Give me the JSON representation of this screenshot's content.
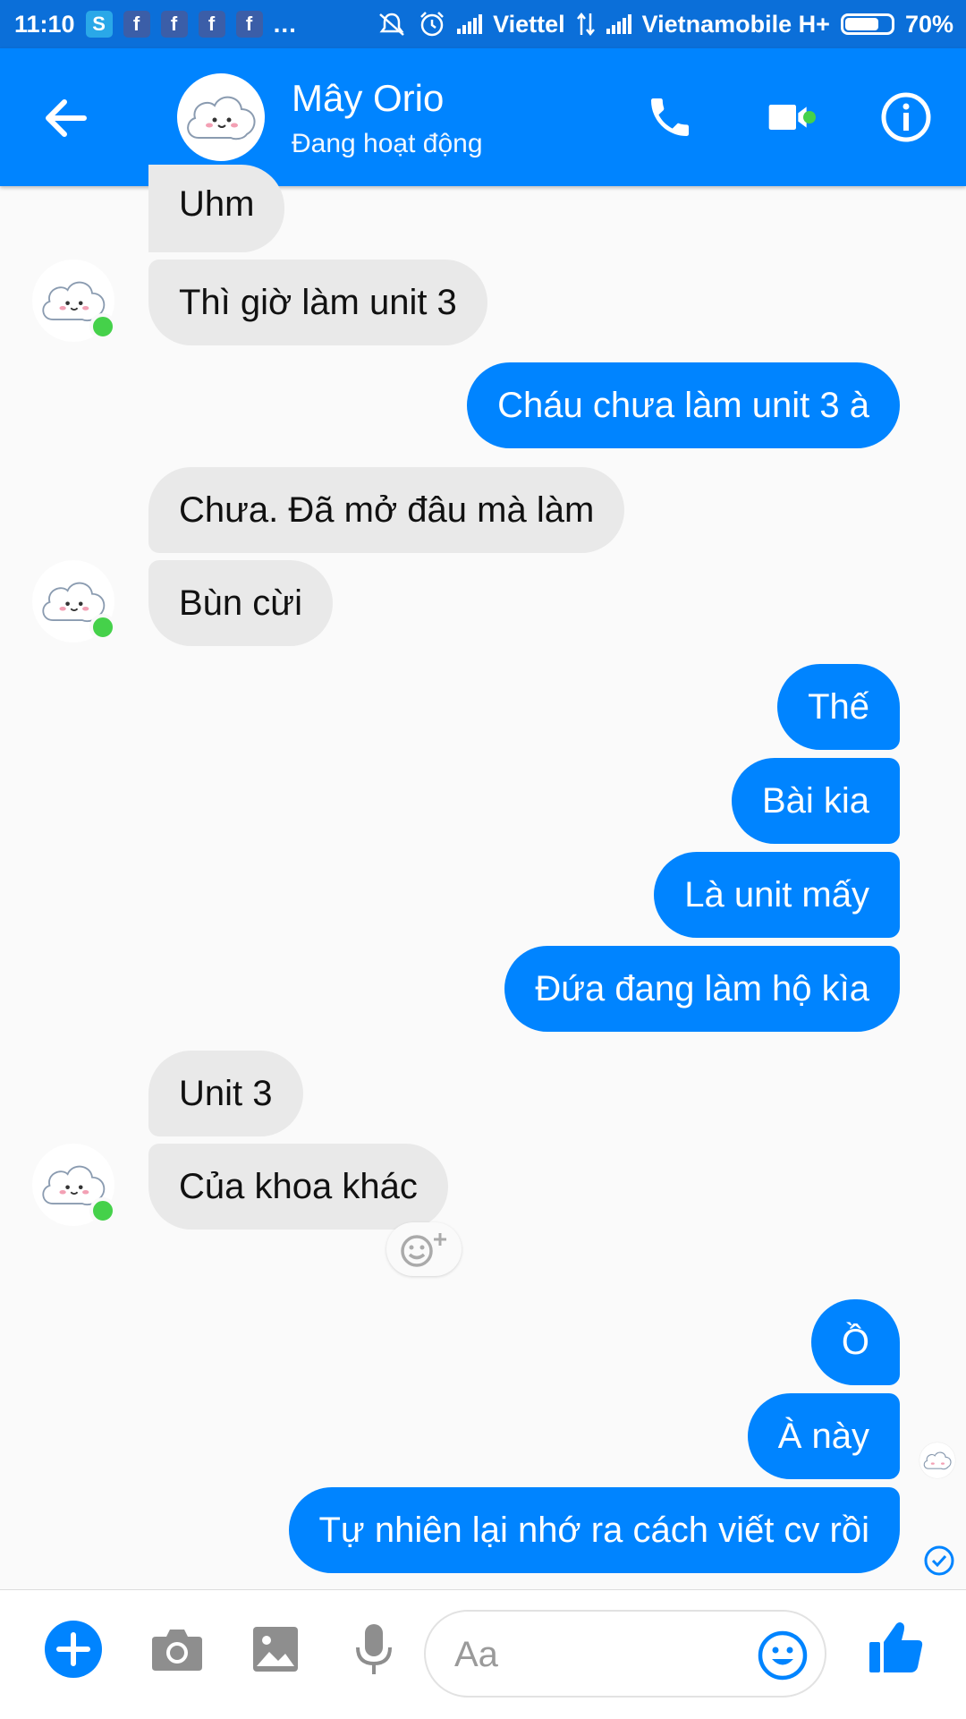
{
  "status_bar": {
    "time": "11:10",
    "carrier1": "Viettel",
    "carrier2": "Vietnamobile H+",
    "battery": "70%",
    "battery_level": 0.7,
    "notification_icons": [
      "skype-icon",
      "facebook-icon",
      "facebook-icon",
      "facebook-icon",
      "facebook-icon"
    ],
    "more": "..."
  },
  "header": {
    "contact_name": "Mây Orio",
    "contact_status": "Đang hoạt động"
  },
  "messages": [
    {
      "side": "in",
      "text": "Uhm"
    },
    {
      "side": "in",
      "text": "Thì giờ làm unit 3"
    },
    {
      "side": "out",
      "text": "Cháu chưa làm unit 3 à"
    },
    {
      "side": "in",
      "text": "Chưa. Đã mở đâu mà làm"
    },
    {
      "side": "in",
      "text": "Bùn cừi"
    },
    {
      "side": "out",
      "text": "Thế"
    },
    {
      "side": "out",
      "text": "Bài kia"
    },
    {
      "side": "out",
      "text": "Là unit mấy"
    },
    {
      "side": "out",
      "text": "Đứa đang làm hộ kìa"
    },
    {
      "side": "in",
      "text": "Unit 3"
    },
    {
      "side": "in",
      "text": "Của khoa khác"
    },
    {
      "side": "out",
      "text": "Ồ"
    },
    {
      "side": "out",
      "text": "À này"
    },
    {
      "side": "out",
      "text": "Tự nhiên lại nhớ ra cách viết cv rồi"
    }
  ],
  "composer": {
    "placeholder": "Aa"
  },
  "colors": {
    "brand": "#0084ff",
    "status_bar": "#0b6fd9",
    "incoming_bubble": "#e9e9e9",
    "online": "#45d14a"
  }
}
